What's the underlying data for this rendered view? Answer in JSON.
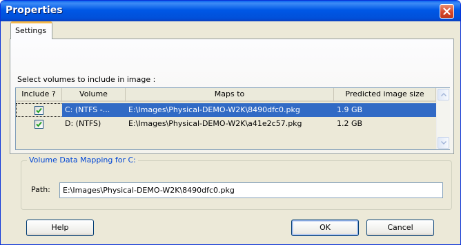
{
  "window": {
    "title": "Properties",
    "close_icon": "close-icon"
  },
  "tabs": [
    {
      "label": "Settings",
      "selected": true
    }
  ],
  "volumes": {
    "instruction": "Select volumes to include in image :",
    "columns": [
      "Include ?",
      "Volume",
      "Maps to",
      "Predicted image size"
    ],
    "rows": [
      {
        "include": true,
        "volume": "C: (NTFS -...",
        "maps_to": "E:\\Images\\Physical-DEMO-W2K\\8490dfc0.pkg",
        "size": "1.9 GB",
        "selected": true
      },
      {
        "include": true,
        "volume": "D: (NTFS)",
        "maps_to": "E:\\Images\\Physical-DEMO-W2K\\a41e2c57.pkg",
        "size": "1.2 GB",
        "selected": false
      }
    ]
  },
  "mapping": {
    "group_title": "Volume Data Mapping for C:",
    "path_label": "Path:",
    "path_value": "E:\\Images\\Physical-DEMO-W2K\\8490dfc0.pkg"
  },
  "buttons": {
    "help": "Help",
    "ok": "OK",
    "cancel": "Cancel"
  },
  "colors": {
    "titlebar": "#0058e6",
    "selection": "#316ac5",
    "group_title": "#0046d5",
    "checkmark": "#21a121"
  }
}
